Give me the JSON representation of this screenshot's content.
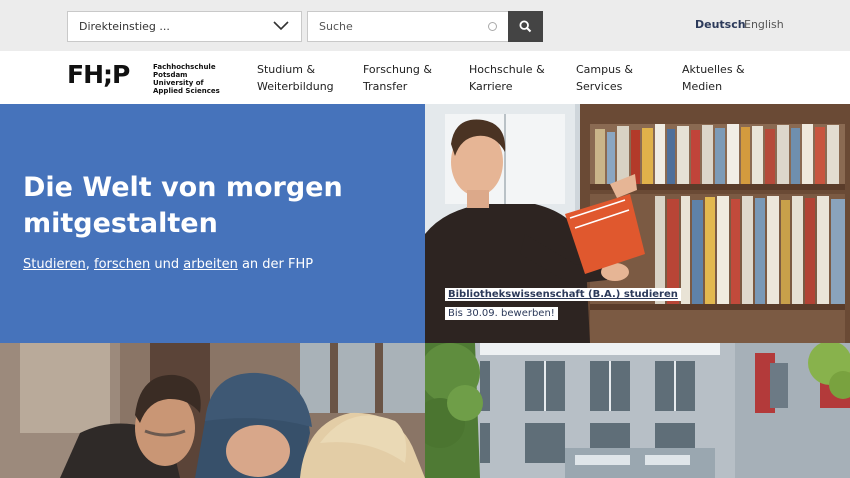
{
  "header": {
    "quick_access": "Direkteinstieg ...",
    "search_placeholder": "Suche",
    "languages": [
      "Deutsch",
      "English"
    ]
  },
  "logo": {
    "mark": "FH;P",
    "line1": "Fachhochschule Potsdam",
    "line2": "University of",
    "line3": "Applied Sciences"
  },
  "nav": [
    {
      "line1": "Studium &",
      "line2": "Weiterbildung"
    },
    {
      "line1": "Forschung &",
      "line2": "Transfer"
    },
    {
      "line1": "Hochschule &",
      "line2": "Karriere"
    },
    {
      "line1": "Campus &",
      "line2": "Services"
    },
    {
      "line1": "Aktuelles &",
      "line2": "Medien"
    }
  ],
  "hero": {
    "title_line1": "Die Welt von morgen",
    "title_line2": "mitgestalten",
    "link1": "Studieren",
    "sep1": ", ",
    "link2": "forschen",
    "sep2": " und ",
    "link3": "arbeiten",
    "tail": " an der FHP"
  },
  "teaser": {
    "title": "Bibliothekswissenschaft (B.A.) studieren",
    "subtitle": "Bis 30.09. bewerben!"
  },
  "colors": {
    "hero_bg": "#4673bb",
    "topbar_bg": "#ececec",
    "caption_text": "#2c3a5a"
  }
}
